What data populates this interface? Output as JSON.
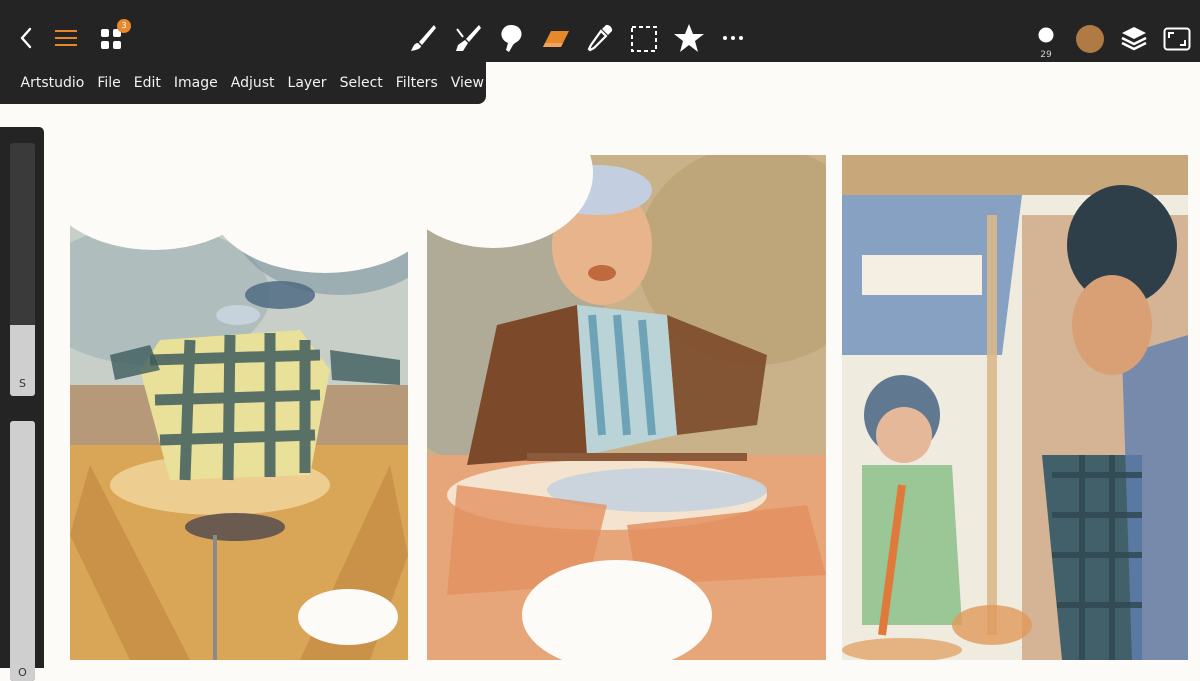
{
  "app": {
    "menu": [
      "Artstudio",
      "File",
      "Edit",
      "Image",
      "Adjust",
      "Layer",
      "Select",
      "Filters",
      "View"
    ]
  },
  "toolbar": {
    "badge_count": "3",
    "brush_size": "29",
    "active_tool": "eraser",
    "tools": [
      "brush-tool",
      "smudge-tool",
      "blob-tool",
      "eraser-tool",
      "eyedropper-tool",
      "selection-tool",
      "favorites-tool",
      "more-tool"
    ],
    "current_color": "#b07a45",
    "accent_color": "#e8882c"
  },
  "sidebar": {
    "size_slider": {
      "label": "S",
      "value_fraction": 0.28
    },
    "opacity_slider": {
      "label": "O",
      "value_fraction": 1.0
    }
  }
}
